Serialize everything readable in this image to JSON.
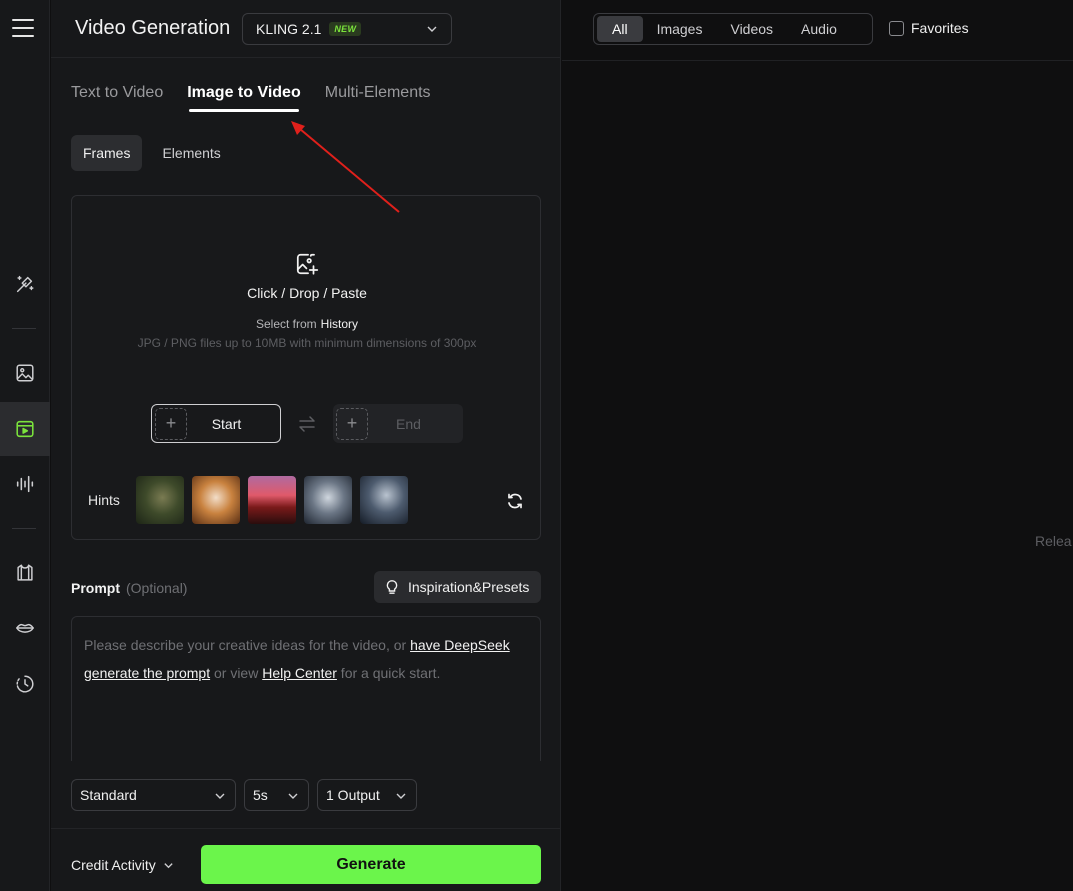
{
  "header": {
    "title": "Video Generation",
    "model": "KLING 2.1",
    "model_badge": "NEW"
  },
  "tabs": [
    "Text to Video",
    "Image to Video",
    "Multi-Elements"
  ],
  "subtabs": [
    "Frames",
    "Elements"
  ],
  "upload": {
    "title": "Click / Drop / Paste",
    "history_prefix": "Select from",
    "history_link": "History",
    "hint": "JPG / PNG files up to 10MB with minimum dimensions of 300px",
    "start_label": "Start",
    "end_label": "End",
    "hints_label": "Hints"
  },
  "prompt": {
    "label": "Prompt",
    "optional": "(Optional)",
    "inspiration_button": "Inspiration&Presets",
    "text_1": "Please describe your creative ideas for the video, or ",
    "link_1": "have DeepSeek generate the prompt",
    "text_2": " or view ",
    "link_2": "Help Center",
    "text_3": " for a quick start."
  },
  "options": {
    "mode": "Standard",
    "duration": "5s",
    "outputs": "1 Output"
  },
  "footer": {
    "credit": "Credit Activity",
    "generate": "Generate"
  },
  "right": {
    "filters": [
      "All",
      "Images",
      "Videos",
      "Audio"
    ],
    "favorites": "Favorites",
    "release_text": "Relea"
  },
  "colors": {
    "accent_green": "#6bf54b",
    "active_icon_green": "#7be33c",
    "annotation_arrow": "#e0201b"
  }
}
